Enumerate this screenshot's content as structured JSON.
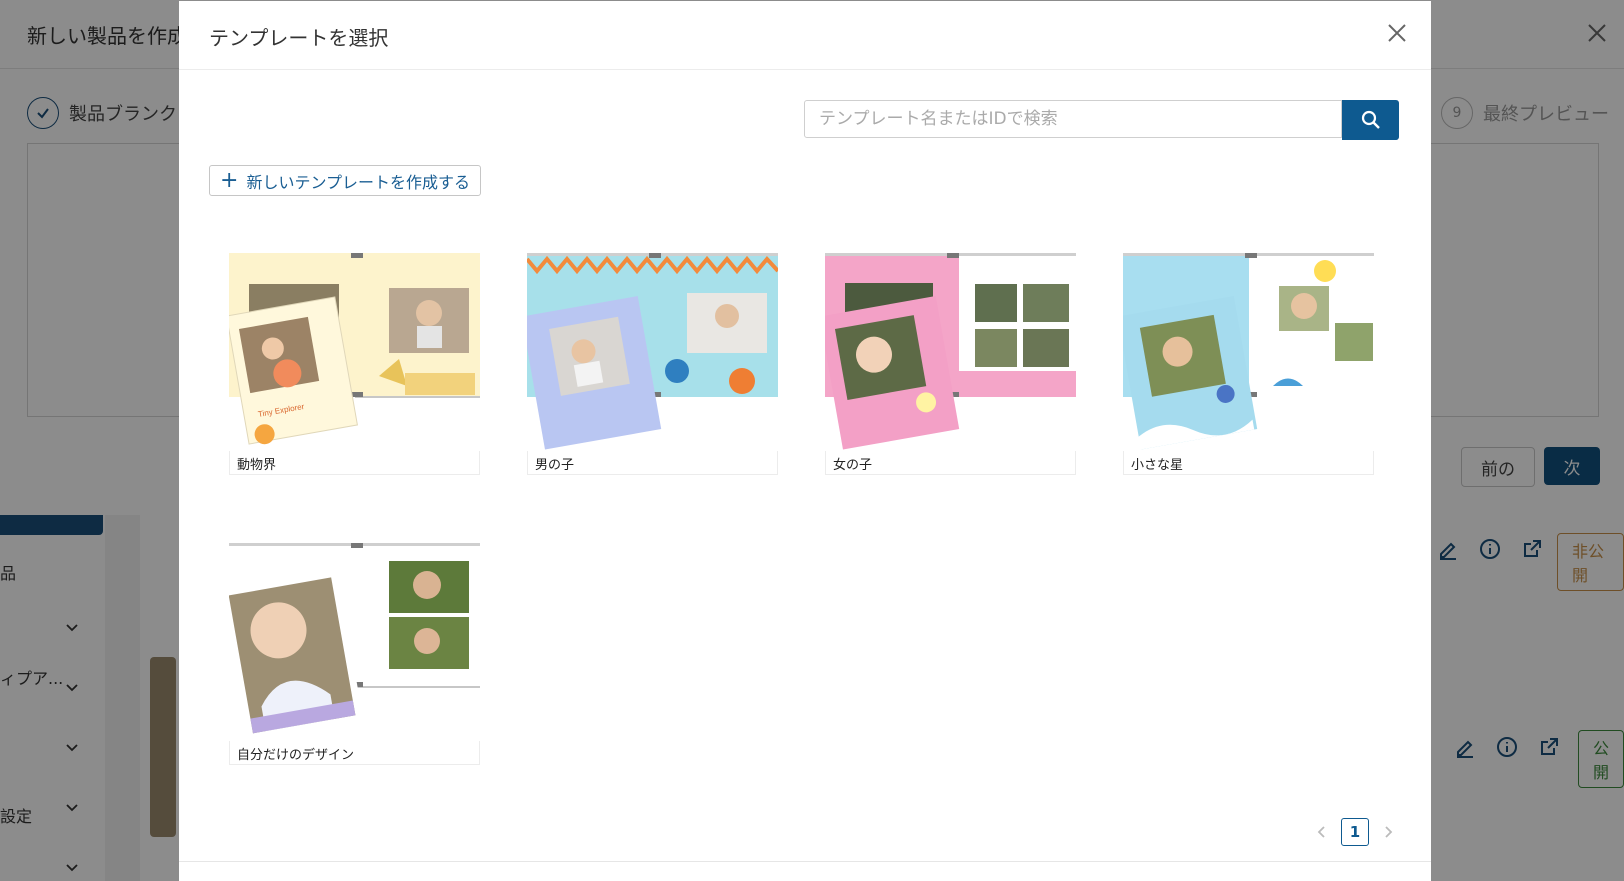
{
  "background": {
    "modal_title": "新しい製品を作成",
    "step_first": "製品ブランク",
    "step_last_number": "9",
    "step_last": "最終プレビュー",
    "prev_button": "前の",
    "next_button": "次",
    "sidebar_items": [
      "品",
      "ィプア...",
      "",
      "設定",
      ""
    ],
    "status_unpublished": "非公開",
    "status_published": "公開"
  },
  "modal": {
    "title": "テンプレートを選択",
    "search": {
      "placeholder": "テンプレート名またはIDで検索",
      "value": ""
    },
    "create_button": "新しいテンプレートを作成する",
    "templates": [
      {
        "name": "動物界",
        "theme": "animal",
        "cover_text": "Tiny Explorer"
      },
      {
        "name": "男の子",
        "theme": "boy",
        "cover_text": ""
      },
      {
        "name": "女の子",
        "theme": "girl",
        "cover_text": ""
      },
      {
        "name": "小さな星",
        "theme": "star",
        "cover_text": ""
      },
      {
        "name": "自分だけのデザイン",
        "theme": "custom",
        "cover_text": ""
      }
    ],
    "pagination": {
      "current_page": "1"
    }
  },
  "colors": {
    "primary": "#0e5a90",
    "overlay": "rgba(0,0,0,0.45)"
  }
}
